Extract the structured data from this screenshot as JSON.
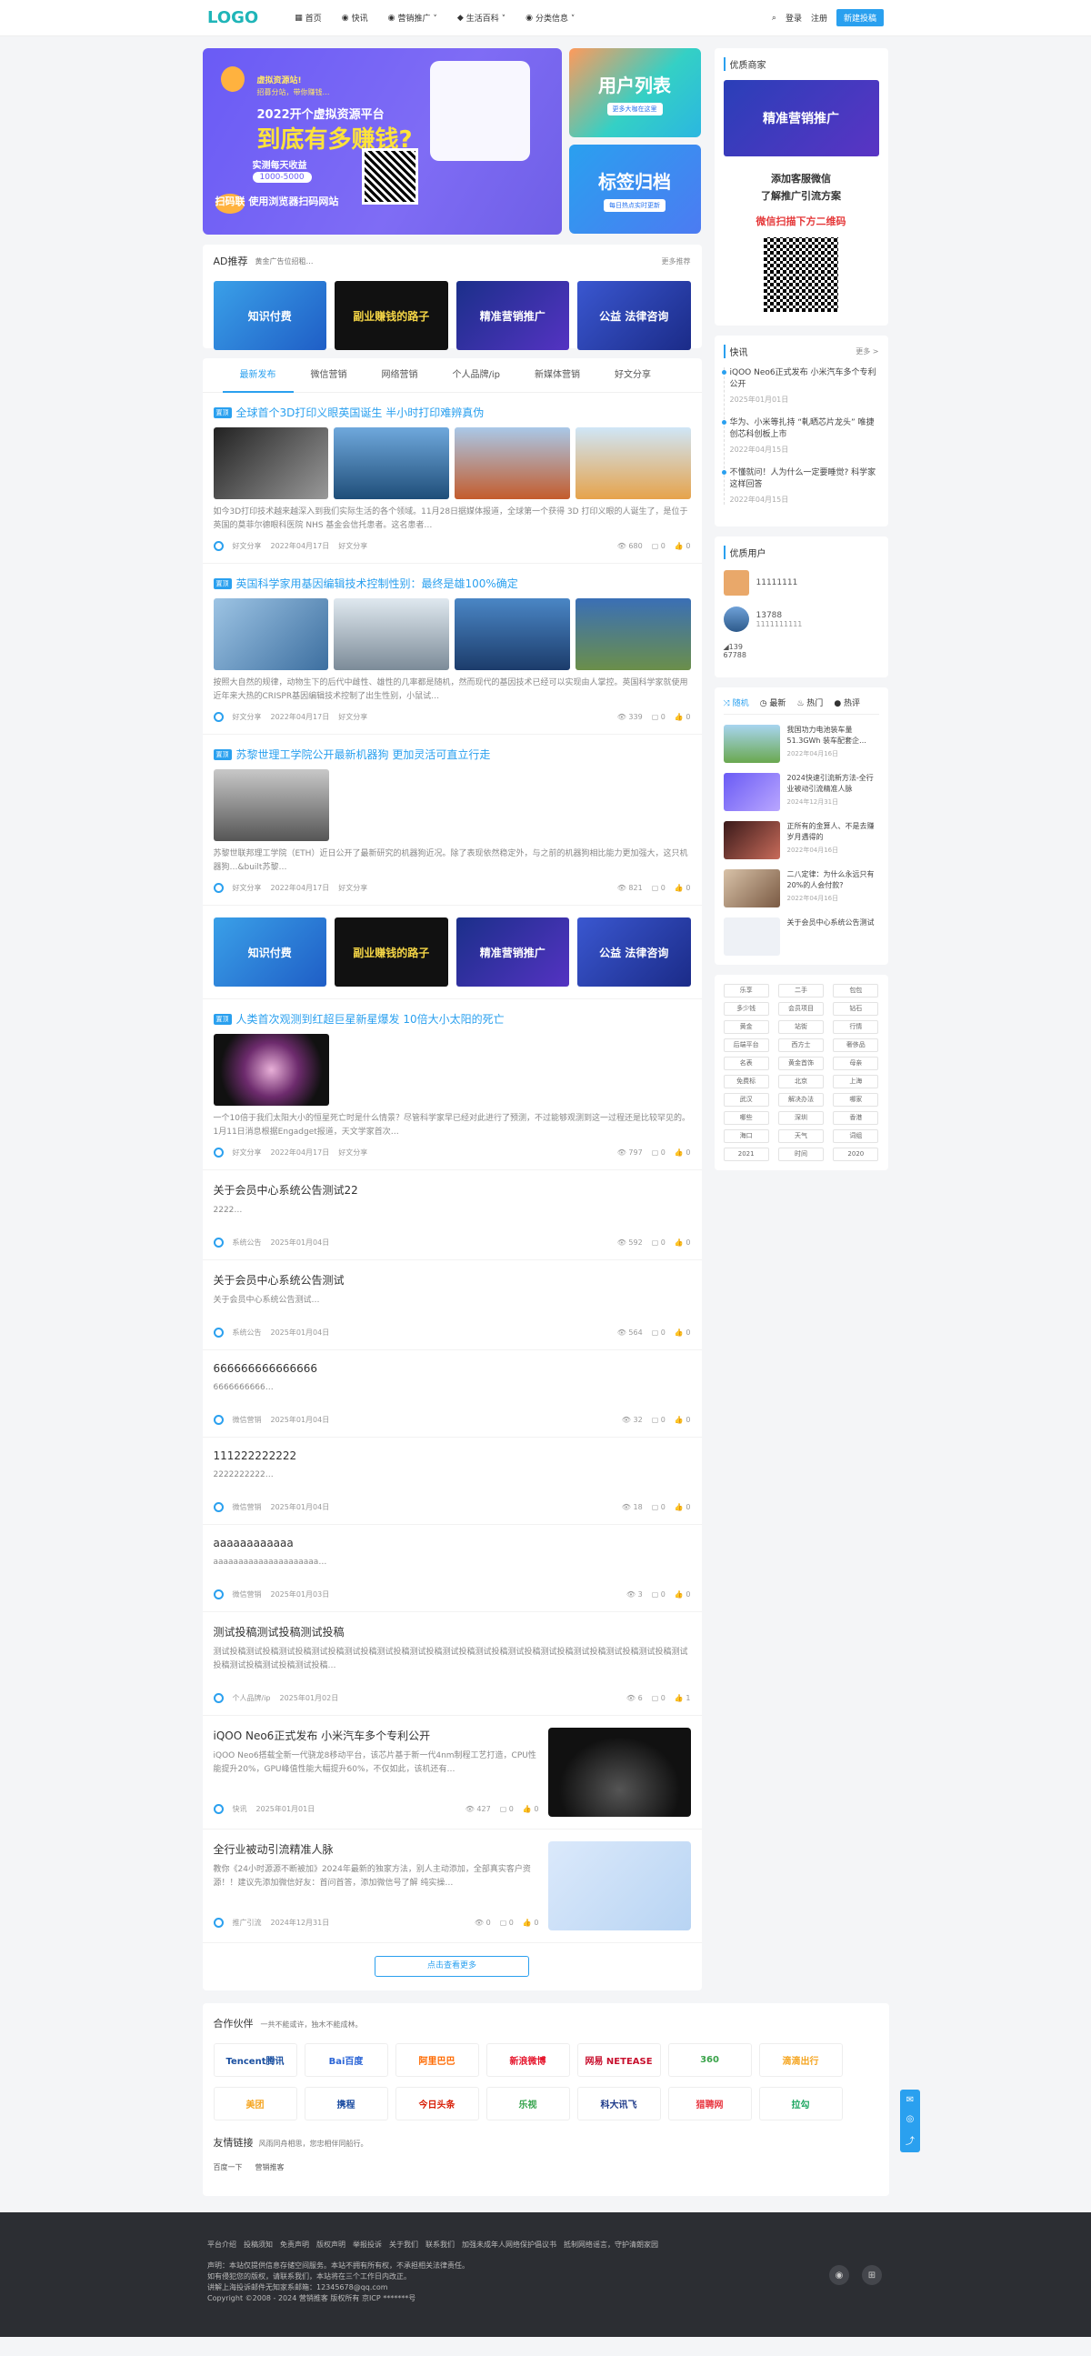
{
  "header": {
    "logo": "LOGO",
    "nav": [
      "首页",
      "快讯",
      "营销推广 ˅",
      "生活百科 ˅",
      "分类信息 ˅"
    ],
    "login": "登录",
    "register": "注册",
    "publish": "新建投稿"
  },
  "hero": {
    "l1": "虚拟资源站!",
    "l2": "招募分站，带你赚钱…",
    "l3": "2022开个虚拟资源平台",
    "l4": "到底有多赚钱?",
    "l5": "实测每天收益",
    "l6": "1000-5000",
    "l7": "扫码联 使用浏览器扫码网站",
    "side1": "用户列表",
    "side1_sub": "更多大咖在这里",
    "side2": "标签归档",
    "side2_sub": "每日热点实时更新"
  },
  "ad": {
    "title": "AD推荐",
    "sub": "黄金广告位招租…",
    "more": "更多推荐",
    "banners": [
      "知识付费",
      "副业赚钱的路子",
      "精准营销推广",
      "公益 法律咨询"
    ]
  },
  "tabs": [
    "最新发布",
    "微信营销",
    "网络营销",
    "个人品牌/ip",
    "新媒体营销",
    "好文分享"
  ],
  "posts": [
    {
      "tag": "置顶",
      "title": "全球首个3D打印义眼英国诞生 半小时打印难辨真伪",
      "desc": "如今3D打印技术越来越深入到我们实际生活的各个领域。11月28日据媒体报道，全球第一个获得 3D 打印义眼的人诞生了，是位于英国的莫菲尔德眼科医院 NHS 基金会信托患者。这名患者…",
      "author": "好文分享",
      "date": "2022年04月17日",
      "cat": "好文分享",
      "views": "680",
      "comments": "0",
      "likes": "0"
    },
    {
      "tag": "置顶",
      "title": "英国科学家用基因编辑技术控制性别：最终是雄100%确定",
      "desc": "按照大自然的规律，动物生下的后代中雌性、雄性的几率都是随机，然而现代的基因技术已经可以实现由人掌控。英国科学家就使用近年来大热的CRISPR基因编辑技术控制了出生性别，小鼠试…",
      "author": "好文分享",
      "date": "2022年04月17日",
      "cat": "好文分享",
      "views": "339",
      "comments": "0",
      "likes": "0"
    },
    {
      "tag": "置顶",
      "title": "苏黎世理工学院公开最新机器狗 更加灵活可直立行走",
      "desc": "苏黎世联邦理工学院（ETH）近日公开了最新研究的机器狗近况。除了表现依然稳定外，与之前的机器狗相比能力更加强大，这只机器狗…&built苏黎…",
      "author": "好文分享",
      "date": "2022年04月17日",
      "cat": "好文分享",
      "views": "821",
      "comments": "0",
      "likes": "0"
    },
    {
      "tag": "置顶",
      "title": "人类首次观测到红超巨星新星爆发 10倍大小太阳的死亡",
      "desc": "一个10倍于我们太阳大小的恒星死亡时是什么情景？尽管科学家早已经对此进行了预测，不过能够观测到这一过程还是比较罕见的。1月11日消息根据Engadget报道，天文学家首次…",
      "author": "好文分享",
      "date": "2022年04月17日",
      "cat": "好文分享",
      "views": "797",
      "comments": "0",
      "likes": "0"
    }
  ],
  "ad_banners2": [
    "知识付费",
    "副业赚钱的路子",
    "精准营销推广",
    "公益 法律咨询"
  ],
  "simple_posts": [
    {
      "title": "关于会员中心系统公告测试22",
      "desc": "2222…",
      "author": "系统公告",
      "date": "2025年01月04日",
      "views": "592",
      "comments": "0",
      "likes": "0"
    },
    {
      "title": "关于会员中心系统公告测试",
      "desc": "关于会员中心系统公告测试…",
      "author": "系统公告",
      "date": "2025年01月04日",
      "views": "564",
      "comments": "0",
      "likes": "0"
    },
    {
      "title": "666666666666666",
      "desc": "6666666666…",
      "author": "微信营销",
      "date": "2025年01月04日",
      "views": "32",
      "comments": "0",
      "likes": "0"
    },
    {
      "title": "111222222222",
      "desc": "2222222222…",
      "author": "微信营销",
      "date": "2025年01月04日",
      "views": "18",
      "comments": "0",
      "likes": "0"
    },
    {
      "title": "aaaaaaaaaaaa",
      "desc": "aaaaaaaaaaaaaaaaaaaaa…",
      "author": "微信营销",
      "date": "2025年01月03日",
      "views": "3",
      "comments": "0",
      "likes": "0"
    },
    {
      "title": "测试投稿测试投稿测试投稿",
      "desc": "测试投稿测试投稿测试投稿测试投稿测试投稿测试投稿测试投稿测试投稿测试投稿测试投稿测试投稿测试投稿测试投稿测试投稿测试投稿测试投稿测试投稿测试投稿…",
      "author": "个人品牌/ip",
      "date": "2025年01月02日",
      "views": "6",
      "comments": "0",
      "likes": "1"
    }
  ],
  "thumb_posts": [
    {
      "title": "iQOO Neo6正式发布 小米汽车多个专利公开",
      "desc": "iQOO Neo6搭载全新一代骁龙8移动平台，该芯片基于新一代4nm制程工艺打造，CPU性能提升20%，GPU峰值性能大幅提升60%，不仅如此，该机还有…",
      "author": "快讯",
      "date": "2025年01月01日",
      "views": "427",
      "comments": "0",
      "likes": "0"
    },
    {
      "title": "全行业被动引流精准人脉",
      "desc": "教你《24小时源源不断被加》2024年最新的独家方法，别人主动添加，全部真实客户资源！！建议先添加微信好友：首问首答，添加微信号了解 纯实操…",
      "author": "推广引流",
      "date": "2024年12月31日",
      "views": "0",
      "comments": "0",
      "likes": "0"
    }
  ],
  "loadmore": "点击查看更多",
  "side": {
    "quality": {
      "title": "优质商家",
      "banner": "精准营销推广",
      "l1": "添加客服微信",
      "l2": "了解推广引流方案",
      "l3": "微信扫描下方二维码"
    },
    "news": {
      "title": "快讯",
      "more": "更多 >",
      "items": [
        {
          "t": "iQOO Neo6正式发布 小米汽车多个专利公开",
          "d": "2025年01月01日"
        },
        {
          "t": "华为、小米等扎持 “軋晒芯片龙头” 唯捷创芯科创板上市",
          "d": "2022年04月15日"
        },
        {
          "t": "不懂就问！人为什么一定要睡觉? 科学家这样回答",
          "d": "2022年04月15日"
        }
      ]
    },
    "users": {
      "title": "优质用户",
      "list": [
        "11111111",
        "13788",
        "1111111111"
      ],
      "stat1": "139",
      "stat2": "67788"
    },
    "hot_tabs": [
      "随机",
      "最新",
      "热门",
      "热评"
    ],
    "hot": [
      {
        "t": "我国功力电池装车量51.3GWh 装车配套企…",
        "d": "2022年04月16日"
      },
      {
        "t": "2024快速引流新方法-全行业被动引流精准人脉",
        "d": "2024年12月31日"
      },
      {
        "t": "正所有的金算人、不是去赚岁月遇得的",
        "d": "2022年04月16日"
      },
      {
        "t": "二八定律：为什么永远只有20%的人会付款?",
        "d": "2022年04月16日"
      },
      {
        "t": "关于会员中心系统公告测试",
        "d": ""
      }
    ],
    "tags": [
      "乐享",
      "二手",
      "包包",
      "多少钱",
      "会员项目",
      "钻石",
      "黄金",
      "站街",
      "行情",
      "后端平台",
      "西方士",
      "奢侈品",
      "名表",
      "黄金首饰",
      "母亲",
      "免费标",
      "北京",
      "上海",
      "武汉",
      "解决办法",
      "哪家",
      "哪些",
      "深圳",
      "香港",
      "海口",
      "天气",
      "词组",
      "2021",
      "时间",
      "2020"
    ]
  },
  "partner": {
    "title": "合作伙伴",
    "sub": "一共不能或许，独木不能成林。",
    "logos": [
      "Tencent腾讯",
      "Bai百度",
      "阿里巴巴",
      "新浪微博",
      "网易 NETEASE",
      "360",
      "滴滴出行",
      "美团",
      "携程",
      "今日头条",
      "乐视",
      "科大讯飞",
      "猎聘网",
      "拉勾"
    ],
    "links_title": "友情链接",
    "links_sub": "风雨同舟相思，您忠相伴同船行。",
    "links": [
      "百度一下",
      "营销推客"
    ]
  },
  "footer": {
    "links": [
      "平台介绍",
      "投稿须知",
      "免责声明",
      "版权声明",
      "举报投诉",
      "关于我们",
      "联系我们",
      "加强未成年人网络保护倡议书",
      "抵制网络谣言，守护清朗家园"
    ],
    "l1": "声明：本站仅提供信息存储空间服务。本站不拥有所有权，不承担相关法律责任。",
    "l2": "如有侵犯您的版权，请联系我们，本站将在三个工作日内改正。",
    "l3": "讲解上海投诉邮件无知家系邮箱：12345678@qq.com",
    "l4": "Copyright ©2008 - 2024 营销推客 版权所有 京ICP *******号"
  },
  "colors": {
    "accent": "#2aa0ef",
    "logo": "#1fb5b8"
  }
}
